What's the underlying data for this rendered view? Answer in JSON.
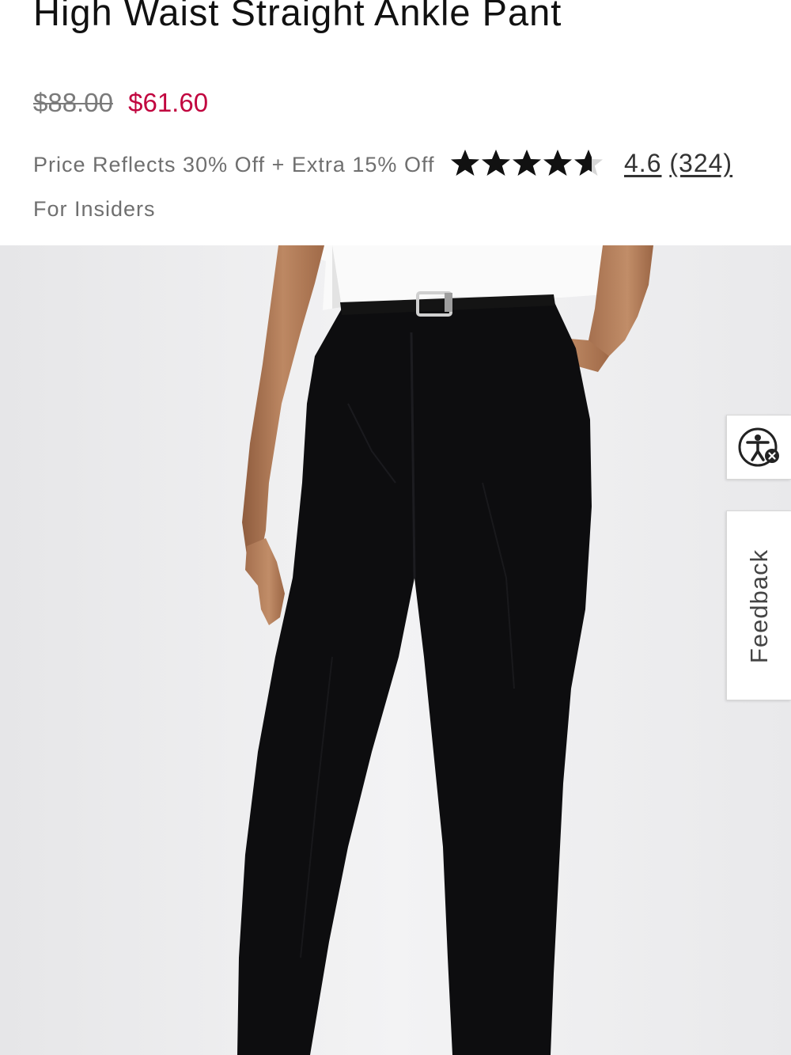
{
  "product": {
    "title": "High Waist Straight Ankle Pant",
    "price_original": "$88.00",
    "price_sale": "$61.60",
    "promo_text": "Price Reflects 30% Off + Extra 15% Off For Insiders",
    "rating": {
      "value": "4.6",
      "count": "(324)",
      "stars_filled_fraction": 0.92,
      "open_paren": ""
    },
    "image_icon": "model-wearing-black-pants-image"
  },
  "widgets": {
    "accessibility_icon": "accessibility-person-icon",
    "feedback_label": "Feedback"
  },
  "colors": {
    "sale_price": "#c1053f",
    "original_price": "#7a7a7a",
    "promo_text": "#6f6f6f",
    "star": "#111111",
    "image_background": "#efeff0"
  }
}
